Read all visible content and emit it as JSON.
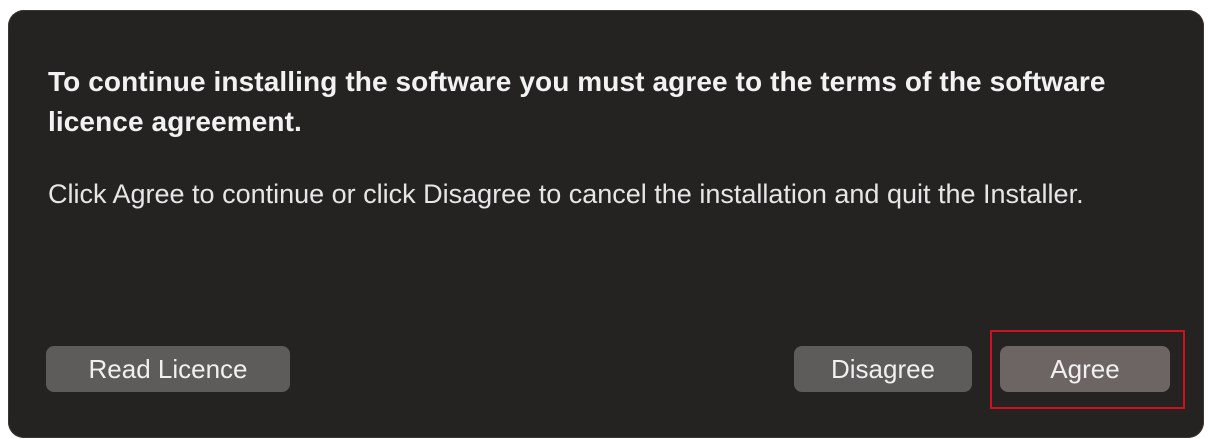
{
  "dialog": {
    "heading": "To continue installing the software you must agree to the terms of the software licence agreement.",
    "message": "Click Agree to continue or click Disagree to cancel the installation and quit the Installer."
  },
  "buttons": {
    "read_licence": "Read Licence",
    "disagree": "Disagree",
    "agree": "Agree"
  },
  "colors": {
    "dialog_background": "#252321",
    "button_background": "#5e5c5a",
    "agree_button_background": "#6d6563",
    "highlight": "#d0101c",
    "text": "#f2f2f2"
  }
}
